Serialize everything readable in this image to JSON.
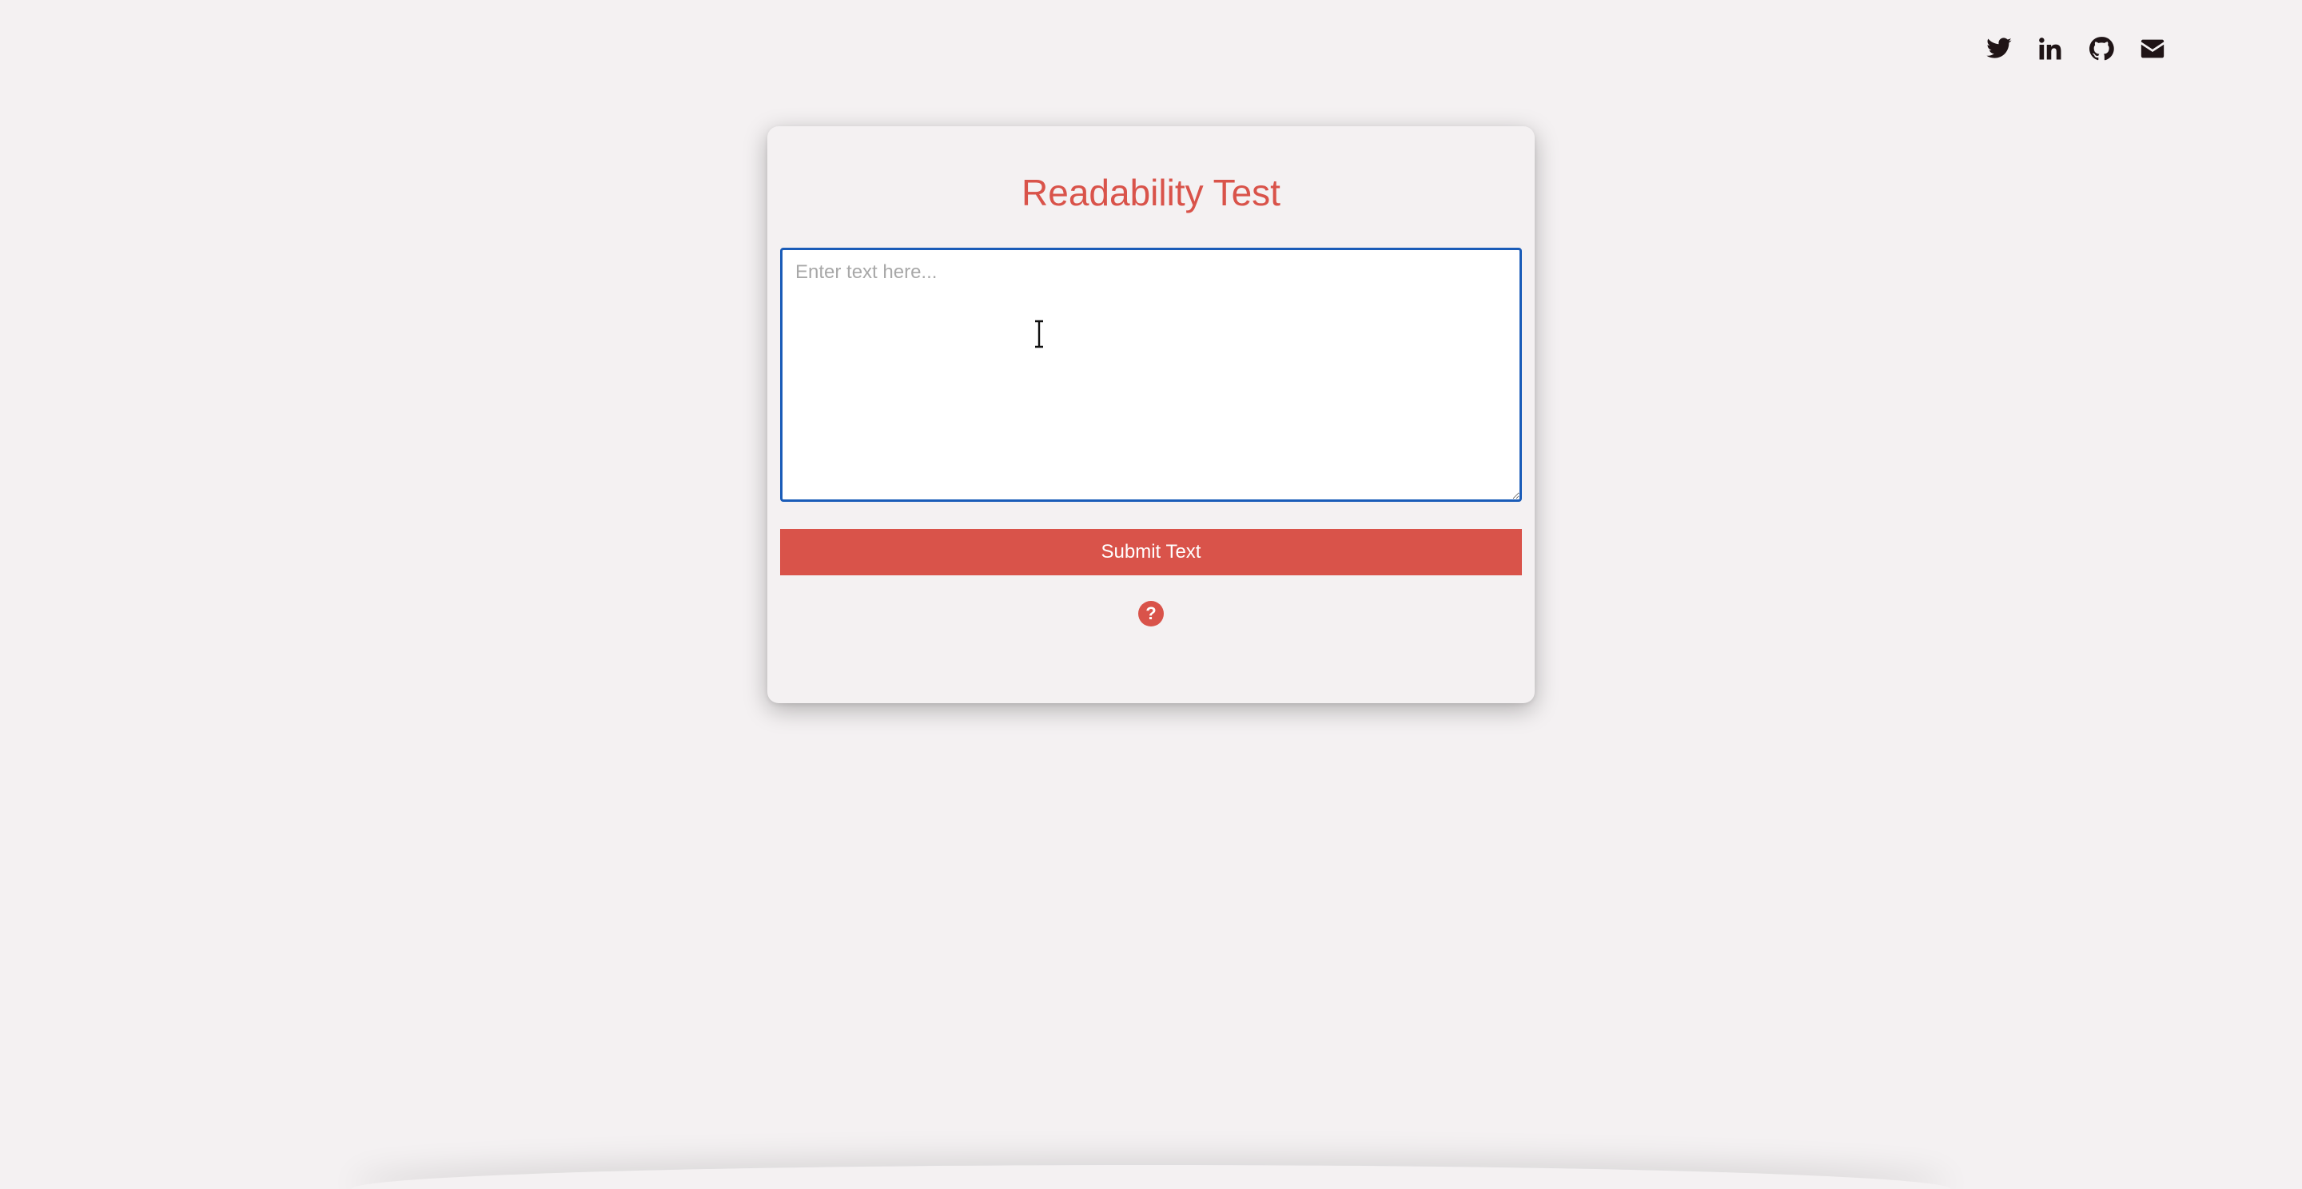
{
  "social": [
    {
      "name": "twitter",
      "icon": "twitter-icon"
    },
    {
      "name": "linkedin",
      "icon": "linkedin-icon"
    },
    {
      "name": "github",
      "icon": "github-icon"
    },
    {
      "name": "email",
      "icon": "envelope-icon"
    }
  ],
  "card": {
    "title": "Readability Test",
    "textarea": {
      "placeholder": "Enter text here...",
      "value": ""
    },
    "submit_label": "Submit Text",
    "help_label": "?"
  },
  "colors": {
    "accent": "#d9534a",
    "background": "#f4f1f2",
    "focus_border": "#1a5cb8",
    "icon": "#1f1416"
  }
}
